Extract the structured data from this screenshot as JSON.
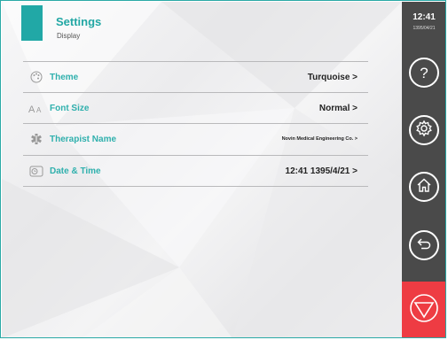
{
  "header": {
    "title": "Settings",
    "subtitle": "Display"
  },
  "rows": [
    {
      "label": "Theme",
      "value": "Turquoise  >",
      "icon": "palette-icon"
    },
    {
      "label": "Font Size",
      "value": "Normal  >",
      "icon": "font-size-icon"
    },
    {
      "label": "Therapist Name",
      "value": "Novin Medical Engineering Co.  >",
      "icon": "medical-star-icon"
    },
    {
      "label": "Date & Time",
      "value": "12:41  1395/4/21  >",
      "icon": "clock-icon"
    }
  ],
  "sidebar": {
    "time": "12:41",
    "date": "1395/04/21",
    "help_label": "?"
  },
  "colors": {
    "accent": "#21a8a6",
    "sidebar": "#4a4a4a",
    "stop": "#ee3c43"
  }
}
